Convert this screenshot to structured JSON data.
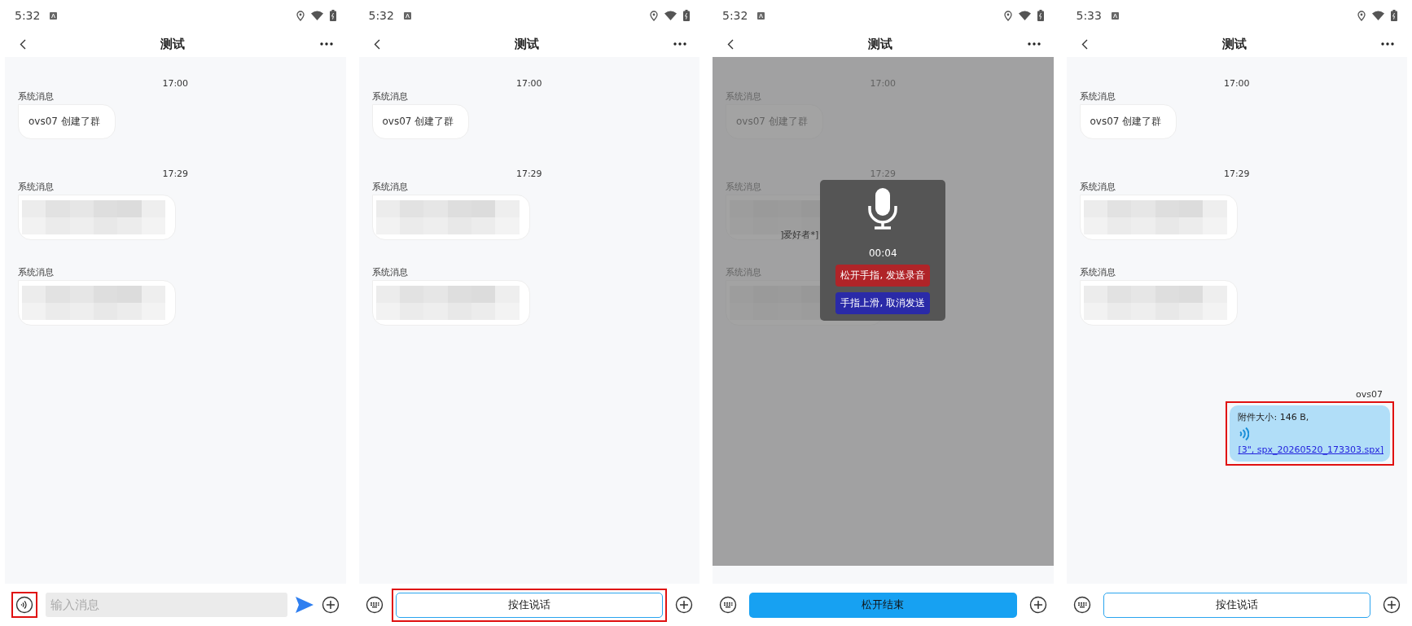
{
  "panels": [
    {
      "status": {
        "time": "5:32"
      },
      "header": {
        "title": "测试"
      },
      "messages": [
        {
          "kind": "time",
          "text": "17:00"
        },
        {
          "kind": "system",
          "sender": "系统消息",
          "text": "ovs07 创建了群"
        },
        {
          "kind": "time",
          "text": "17:29"
        },
        {
          "kind": "blurred",
          "sender": "系统消息"
        },
        {
          "kind": "blurred",
          "sender": "系统消息"
        }
      ],
      "input_bar": {
        "kind": "text",
        "toggle_highlighted": true,
        "placeholder": "输入消息"
      }
    },
    {
      "status": {
        "time": "5:32"
      },
      "header": {
        "title": "测试"
      },
      "messages": [
        {
          "kind": "time",
          "text": "17:00"
        },
        {
          "kind": "system",
          "sender": "系统消息",
          "text": "ovs07 创建了群"
        },
        {
          "kind": "time",
          "text": "17:29"
        },
        {
          "kind": "blurred",
          "sender": "系统消息"
        },
        {
          "kind": "blurred",
          "sender": "系统消息"
        }
      ],
      "input_bar": {
        "kind": "voice",
        "label": "按住说话",
        "pressed": false,
        "highlighted": true
      }
    },
    {
      "status": {
        "time": "5:32"
      },
      "header": {
        "title": "测试"
      },
      "messages": [
        {
          "kind": "time",
          "text": "17:00"
        },
        {
          "kind": "system",
          "sender": "系统消息",
          "text": "ovs07 创建了群"
        },
        {
          "kind": "time",
          "text": "17:29"
        },
        {
          "kind": "blurred",
          "sender": "系统消息"
        },
        {
          "kind": "blurred",
          "sender": "系统消息"
        }
      ],
      "recording": {
        "fragment": "]爱好者*]",
        "timer": "00:04",
        "release_hint": "松开手指, 发送录音",
        "cancel_hint": "手指上滑, 取消发送"
      },
      "input_bar": {
        "kind": "voice",
        "label": "松开结束",
        "pressed": true,
        "highlighted": false
      }
    },
    {
      "status": {
        "time": "5:33"
      },
      "header": {
        "title": "测试"
      },
      "messages": [
        {
          "kind": "time",
          "text": "17:00"
        },
        {
          "kind": "system",
          "sender": "系统消息",
          "text": "ovs07 创建了群"
        },
        {
          "kind": "time",
          "text": "17:29"
        },
        {
          "kind": "blurred",
          "sender": "系统消息"
        },
        {
          "kind": "blurred",
          "sender": "系统消息"
        },
        {
          "kind": "voice",
          "sender": "ovs07",
          "size_text": "附件大小: 146 B,",
          "link": "[3\", spx_20260520_173303.spx]",
          "highlighted": true
        }
      ],
      "input_bar": {
        "kind": "voice",
        "label": "按住说话",
        "pressed": false,
        "highlighted": false
      }
    }
  ]
}
